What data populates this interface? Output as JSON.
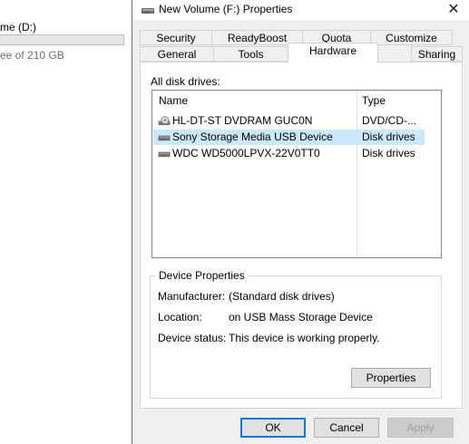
{
  "background": {
    "drive_label": "me (D:)",
    "free_text": "ee of 210 GB"
  },
  "dialog": {
    "title": "New Volume (F:) Properties",
    "close_glyph": "✕",
    "tabs_top": [
      {
        "label": "Security"
      },
      {
        "label": "ReadyBoost"
      },
      {
        "label": "Quota"
      },
      {
        "label": "Customize"
      }
    ],
    "tabs_bottom": [
      {
        "label": "General"
      },
      {
        "label": "Tools"
      },
      {
        "label": "Hardware",
        "active": true
      },
      {
        "label": "Sharing"
      }
    ],
    "all_disk_drives_label": "All disk drives:",
    "columns": {
      "name": "Name",
      "type": "Type"
    },
    "drives": [
      {
        "name": "HL-DT-ST DVDRAM GUC0N",
        "type": "DVD/CD-...",
        "icon": "optical-drive-icon"
      },
      {
        "name": "Sony Storage Media USB Device",
        "type": "Disk drives",
        "icon": "disk-drive-icon",
        "selected": true
      },
      {
        "name": "WDC WD5000LPVX-22V0TT0",
        "type": "Disk drives",
        "icon": "disk-drive-icon"
      }
    ],
    "device_properties": {
      "title": "Device Properties",
      "manufacturer_label": "Manufacturer:",
      "manufacturer_value": "(Standard disk drives)",
      "location_label": "Location:",
      "location_value": "on USB Mass Storage Device",
      "status_label": "Device status:",
      "status_value": "This device is working properly.",
      "properties_button": "Properties"
    },
    "buttons": {
      "ok": "OK",
      "cancel": "Cancel",
      "apply": "Apply"
    }
  }
}
